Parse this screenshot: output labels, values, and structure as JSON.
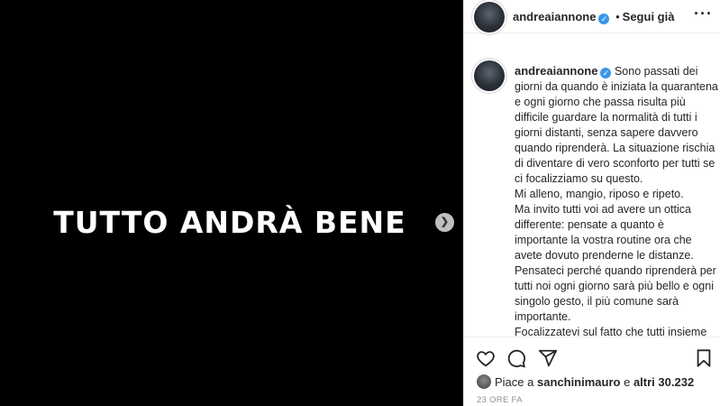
{
  "media": {
    "text": "TUTTO ANDRÀ BENE",
    "next_icon": "chevron-right-icon"
  },
  "header": {
    "username": "andreaiannone",
    "separator": "•",
    "follow_status": "Segui già",
    "more_icon": "ellipsis-icon"
  },
  "post": {
    "username": "andreaiannone",
    "caption_lines": [
      "Sono passati dei giorni da quando è iniziata la quarantena e ogni giorno che passa risulta più difficile guardare la normalità di tutti i giorni distanti, senza sapere davvero quando riprenderà. La situazione rischia di diventare di vero sconforto per tutti se ci focalizziamo su questo.",
      "Mi alleno, mangio, riposo e ripeto.",
      "Ma invito tutti voi ad avere un ottica differente: pensate a quanto è importante la vostra routine ora che avete dovuto prenderne le distanze.",
      "Pensateci perché quando riprenderà per tutti noi ogni giorno sarà più bello e ogni singolo gesto, il più comune sarà importante.",
      "Focalizzatevi sul fatto che tutti insieme stiamo vivendo una battaglia unica che"
    ]
  },
  "actions": {
    "like_icon": "heart-icon",
    "comment_icon": "comment-icon",
    "share_icon": "paper-plane-icon",
    "save_icon": "bookmark-icon"
  },
  "likes": {
    "prefix": "Piace a",
    "liker": "sanchinimauro",
    "connector": "e",
    "others": "altri 30.232"
  },
  "timestamp": "23 ORE FA",
  "colors": {
    "verified_badge": "#3897f0",
    "media_background": "#000000"
  }
}
